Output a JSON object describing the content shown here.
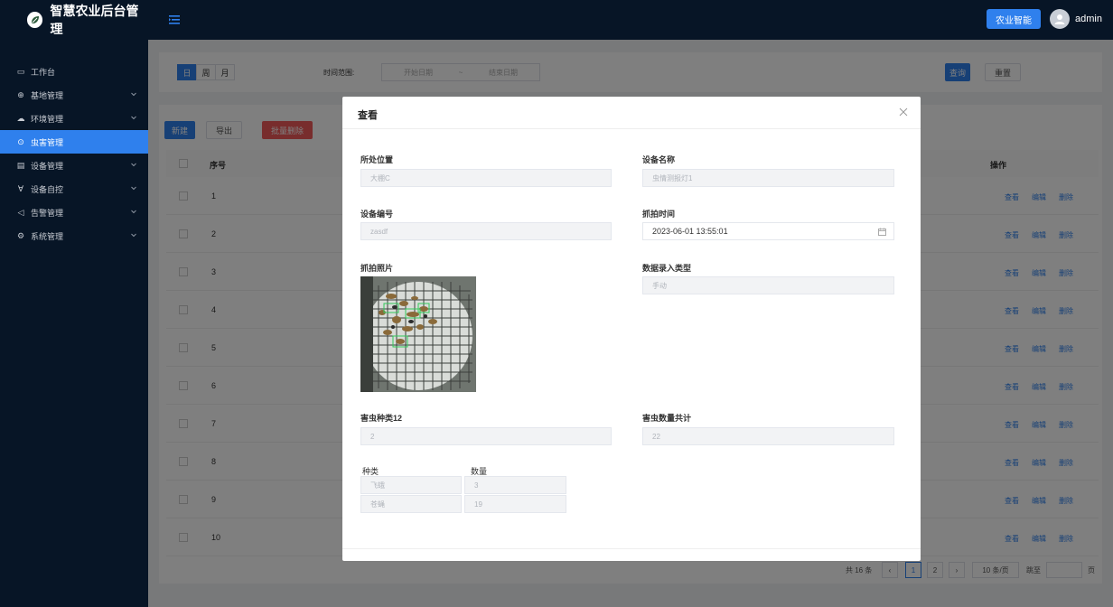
{
  "app": {
    "title": "智慧农业后台管理",
    "cert_button": "农业智能",
    "username": "admin"
  },
  "sidebar": {
    "items": [
      {
        "label": "工作台",
        "icon": "monitor-icon",
        "chevron": false,
        "active": false
      },
      {
        "label": "基地管理",
        "icon": "globe-icon",
        "chevron": true,
        "active": false
      },
      {
        "label": "环境管理",
        "icon": "cloud-icon",
        "chevron": true,
        "active": false
      },
      {
        "label": "虫害管理",
        "icon": "bug-icon",
        "chevron": false,
        "active": true
      },
      {
        "label": "设备管理",
        "icon": "device-icon",
        "chevron": true,
        "active": false
      },
      {
        "label": "设备自控",
        "icon": "control-icon",
        "chevron": true,
        "active": false
      },
      {
        "label": "告警管理",
        "icon": "alarm-icon",
        "chevron": true,
        "active": false
      },
      {
        "label": "系统管理",
        "icon": "gear-icon",
        "chevron": true,
        "active": false
      }
    ]
  },
  "filters": {
    "period_tabs": [
      "日",
      "周",
      "月"
    ],
    "time_range_label": "时间范围:",
    "start_placeholder": "开始日期",
    "range_sep": "~",
    "end_placeholder": "结束日期",
    "query_button": "查询",
    "reset_button": "重置"
  },
  "toolbar": {
    "new_button": "新建",
    "export_button": "导出",
    "batch_delete_button": "批量删除"
  },
  "table": {
    "columns": {
      "index": "序号",
      "actions": "操作"
    },
    "rows": [
      "1",
      "2",
      "3",
      "4",
      "5",
      "6",
      "7",
      "8",
      "9",
      "10"
    ],
    "row_actions": {
      "view": "查看",
      "edit": "编辑",
      "delete": "删除"
    }
  },
  "pagination": {
    "total": "共 16 条",
    "pages": [
      "1",
      "2"
    ],
    "page_size": "10 条/页",
    "goto_label": "跳至",
    "goto_suffix": "页"
  },
  "modal": {
    "title": "查看",
    "location_label": "所处位置",
    "location_value": "大棚C",
    "device_name_label": "设备名称",
    "device_name_value": "虫情测报灯1",
    "device_code_label": "设备编号",
    "device_code_value": "zasdf",
    "capture_time_label": "抓拍时间",
    "capture_time_value": "2023-06-01 13:55:01",
    "photo_label": "抓拍照片",
    "entry_type_label": "数据录入类型",
    "entry_type_value": "手动",
    "species_label": "害虫种类12",
    "species_value": "2",
    "count_label": "害虫数量共计",
    "count_value": "22",
    "sub_table": {
      "headers": [
        "种类",
        "数量"
      ],
      "rows": [
        {
          "kind": "飞蛾",
          "qty": "3"
        },
        {
          "kind": "苍蝇",
          "qty": "19"
        }
      ]
    }
  }
}
